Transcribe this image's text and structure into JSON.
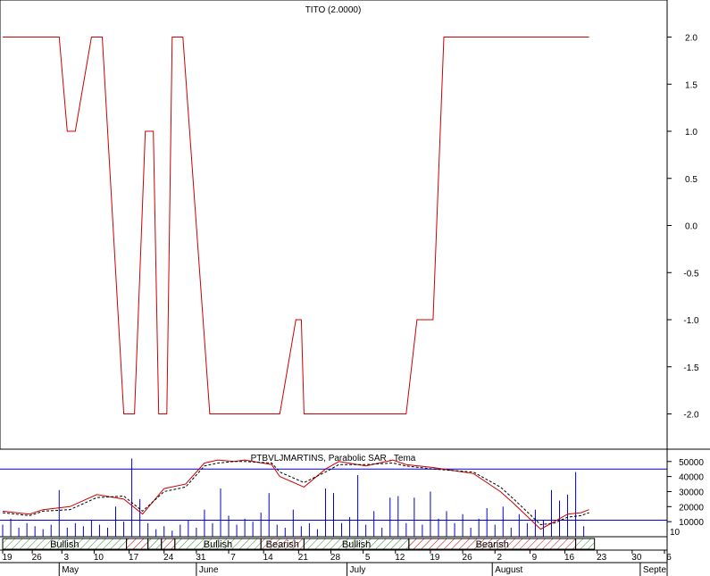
{
  "chart_data": [
    {
      "type": "line",
      "title": "TITO (2.0000)",
      "ylim": [
        -2.4,
        2.4
      ],
      "y_ticks": [
        "2.0",
        "1.5",
        "1.0",
        "0.5",
        "0.0",
        "-0.5",
        "-1.0",
        "-1.5",
        "-2.0"
      ],
      "y_tick_values": [
        2.0,
        1.5,
        1.0,
        0.5,
        0.0,
        -0.5,
        -1.0,
        -1.5,
        -2.0
      ],
      "series_color": "#cc0000",
      "series": [
        {
          "x": [
            0,
            21,
            24,
            27,
            33,
            37,
            45,
            49,
            53,
            56,
            58,
            61,
            63,
            67,
            77,
            103,
            109,
            111,
            112,
            150,
            154,
            160,
            164,
            218
          ],
          "values": [
            2,
            2,
            1,
            1,
            2,
            2,
            -2,
            -2,
            1,
            1,
            -2,
            -2,
            2,
            2,
            -2,
            -2,
            -1,
            -1,
            -2,
            -2,
            -1,
            -1,
            2,
            2
          ]
        }
      ]
    },
    {
      "type": "line+bar",
      "title": "PTBVLJMARTINS, Parabolic SAR , Tema",
      "ylim": [
        0,
        57000
      ],
      "y_ticks": [
        "50000",
        "40000",
        "30000",
        "20000",
        "10000"
      ],
      "y_tick_values": [
        50000,
        40000,
        30000,
        20000,
        10000
      ],
      "corner_label": "10",
      "h_lines": [
        45000,
        11000
      ],
      "line_color": "#cc0000",
      "dash_color": "#000000",
      "bar_color": "#0000cc",
      "series": [
        {
          "name": "",
          "x": [
            0,
            10,
            15,
            25,
            35,
            45,
            52,
            60,
            68,
            75,
            80,
            86,
            90,
            100,
            103,
            112,
            120,
            125,
            135,
            145,
            150,
            160,
            175,
            185,
            190,
            200,
            205,
            210,
            215,
            218
          ],
          "values": [
            17000,
            15000,
            18000,
            20000,
            28000,
            25000,
            15000,
            32000,
            35000,
            49000,
            51000,
            50000,
            51000,
            48000,
            40000,
            33000,
            45000,
            50000,
            47000,
            51000,
            48000,
            46000,
            42000,
            30000,
            22000,
            5000,
            10000,
            15000,
            16000,
            18000
          ]
        },
        {
          "name": "",
          "x": [
            0,
            10,
            15,
            25,
            35,
            45,
            52,
            60,
            68,
            75,
            80,
            86,
            90,
            100,
            103,
            112,
            120,
            125,
            135,
            145,
            150,
            160,
            175,
            185,
            190,
            200,
            205,
            210,
            215,
            218
          ],
          "values": [
            16000,
            14000,
            17000,
            18000,
            26000,
            27000,
            17000,
            30000,
            33000,
            47000,
            49000,
            50000,
            50000,
            49000,
            43000,
            36000,
            43000,
            48000,
            48000,
            49000,
            47000,
            45000,
            43000,
            33000,
            25000,
            8000,
            9000,
            13000,
            14000,
            16000
          ]
        }
      ],
      "volume_bars": {
        "x": [
          0,
          3,
          6,
          9,
          12,
          15,
          18,
          21,
          24,
          27,
          30,
          33,
          36,
          39,
          42,
          45,
          48,
          51,
          54,
          57,
          60,
          63,
          66,
          69,
          72,
          75,
          78,
          81,
          84,
          87,
          90,
          93,
          96,
          99,
          102,
          105,
          108,
          111,
          114,
          117,
          120,
          123,
          126,
          129,
          132,
          135,
          138,
          141,
          144,
          147,
          150,
          153,
          156,
          159,
          162,
          165,
          168,
          171,
          174,
          177,
          180,
          183,
          186,
          189,
          192,
          195,
          198,
          201,
          204,
          207,
          210,
          213,
          216
        ],
        "values": [
          8000,
          12000,
          6000,
          9000,
          7000,
          5000,
          8000,
          31000,
          6000,
          9000,
          7000,
          11000,
          8000,
          6000,
          20000,
          10000,
          52000,
          25000,
          9000,
          5000,
          7000,
          4000,
          8000,
          11000,
          6000,
          18000,
          9000,
          32000,
          14000,
          8000,
          12000,
          10000,
          16000,
          29000,
          8000,
          6000,
          18000,
          7000,
          9000,
          5000,
          32000,
          29000,
          9000,
          13000,
          41000,
          8000,
          17000,
          6000,
          26000,
          27000,
          9000,
          26000,
          8000,
          30000,
          12000,
          17000,
          9000,
          15000,
          6000,
          12000,
          19000,
          8000,
          20000,
          6000,
          15000,
          9000,
          18000,
          11000,
          31000,
          24000,
          28000,
          43000,
          7000
        ]
      }
    }
  ],
  "indicator_bands": [
    {
      "label": "Bullish",
      "start": 0,
      "end": 46,
      "kind": "bullish"
    },
    {
      "label": "",
      "start": 46,
      "end": 54,
      "kind": "bearish"
    },
    {
      "label": "",
      "start": 54,
      "end": 59,
      "kind": "bullish"
    },
    {
      "label": "",
      "start": 59,
      "end": 64,
      "kind": "bearish"
    },
    {
      "label": "Bullish",
      "start": 64,
      "end": 96,
      "kind": "bullish"
    },
    {
      "label": "Bearish",
      "start": 96,
      "end": 112,
      "kind": "bearish"
    },
    {
      "label": "Bullish",
      "start": 112,
      "end": 151,
      "kind": "bullish"
    },
    {
      "label": "Bearish",
      "start": 151,
      "end": 213,
      "kind": "bearish"
    },
    {
      "label": "",
      "start": 213,
      "end": 220,
      "kind": "bullish"
    }
  ],
  "x_axis": {
    "day_ticks": [
      {
        "label": "19",
        "x": 0
      },
      {
        "label": "26",
        "x": 11
      },
      {
        "label": "3",
        "x": 22
      },
      {
        "label": "10",
        "x": 34
      },
      {
        "label": "17",
        "x": 47
      },
      {
        "label": "24",
        "x": 60
      },
      {
        "label": "31",
        "x": 72
      },
      {
        "label": "7",
        "x": 84
      },
      {
        "label": "14",
        "x": 97
      },
      {
        "label": "21",
        "x": 110
      },
      {
        "label": "28",
        "x": 122
      },
      {
        "label": "5",
        "x": 134
      },
      {
        "label": "12",
        "x": 146
      },
      {
        "label": "19",
        "x": 159
      },
      {
        "label": "26",
        "x": 171
      },
      {
        "label": "2",
        "x": 183
      },
      {
        "label": "9",
        "x": 196
      },
      {
        "label": "16",
        "x": 209
      },
      {
        "label": "23",
        "x": 221
      },
      {
        "label": "30",
        "x": 234
      },
      {
        "label": "6",
        "x": 246
      }
    ],
    "month_labels": [
      {
        "label": "May",
        "x": 21
      },
      {
        "label": "June",
        "x": 72
      },
      {
        "label": "July",
        "x": 128
      },
      {
        "label": "August",
        "x": 182
      },
      {
        "label": "Septe",
        "x": 237
      }
    ],
    "x_range": [
      -1,
      247
    ]
  },
  "colors": {
    "line": "#cc0000",
    "volume": "#0000cc",
    "bullish_hatch": "#2e8b2e",
    "bearish_hatch": "#cc0000",
    "frame": "#000000"
  }
}
